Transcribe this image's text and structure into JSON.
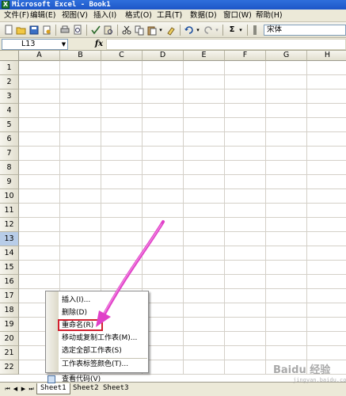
{
  "window": {
    "title": "Microsoft Excel - Book1"
  },
  "menu": [
    {
      "label": "文件(F)"
    },
    {
      "label": "编辑(E)"
    },
    {
      "label": "视图(V)"
    },
    {
      "label": "插入(I)"
    },
    {
      "label": "格式(O)"
    },
    {
      "label": "工具(T)"
    },
    {
      "label": "数据(D)"
    },
    {
      "label": "窗口(W)"
    },
    {
      "label": "帮助(H)"
    }
  ],
  "toolbar": {
    "sum_symbol": "Σ",
    "font_name": "宋体"
  },
  "formula_bar": {
    "name_box": "L13",
    "fx_label": "fx",
    "content": ""
  },
  "grid": {
    "columns": [
      "A",
      "B",
      "C",
      "D",
      "E",
      "F",
      "G",
      "H"
    ],
    "rows": [
      "1",
      "2",
      "3",
      "4",
      "5",
      "6",
      "7",
      "8",
      "9",
      "10",
      "11",
      "12",
      "13",
      "14",
      "15",
      "16",
      "17",
      "18",
      "19",
      "20",
      "21",
      "22"
    ],
    "active_row": "13"
  },
  "sheet_tabs": {
    "tabs": [
      "Sheet1",
      "Sheet2",
      "Sheet3"
    ],
    "active": "Sheet1"
  },
  "context_menu": {
    "items": [
      {
        "label": "插入(I)..."
      },
      {
        "label": "删除(D)"
      },
      {
        "label": "重命名(R)"
      },
      {
        "label": "移动或复制工作表(M)..."
      },
      {
        "label": "选定全部工作表(S)"
      },
      {
        "label": "工作表标签颜色(T)..."
      },
      {
        "label": "查看代码(V)"
      }
    ],
    "highlighted": "重命名(R)",
    "highlight_color": "#d21f2e"
  },
  "annotation": {
    "arrow_color": "#e040c8"
  },
  "watermark": {
    "text": "Baidu 经验",
    "sub": "jingyan.baidu.com"
  }
}
